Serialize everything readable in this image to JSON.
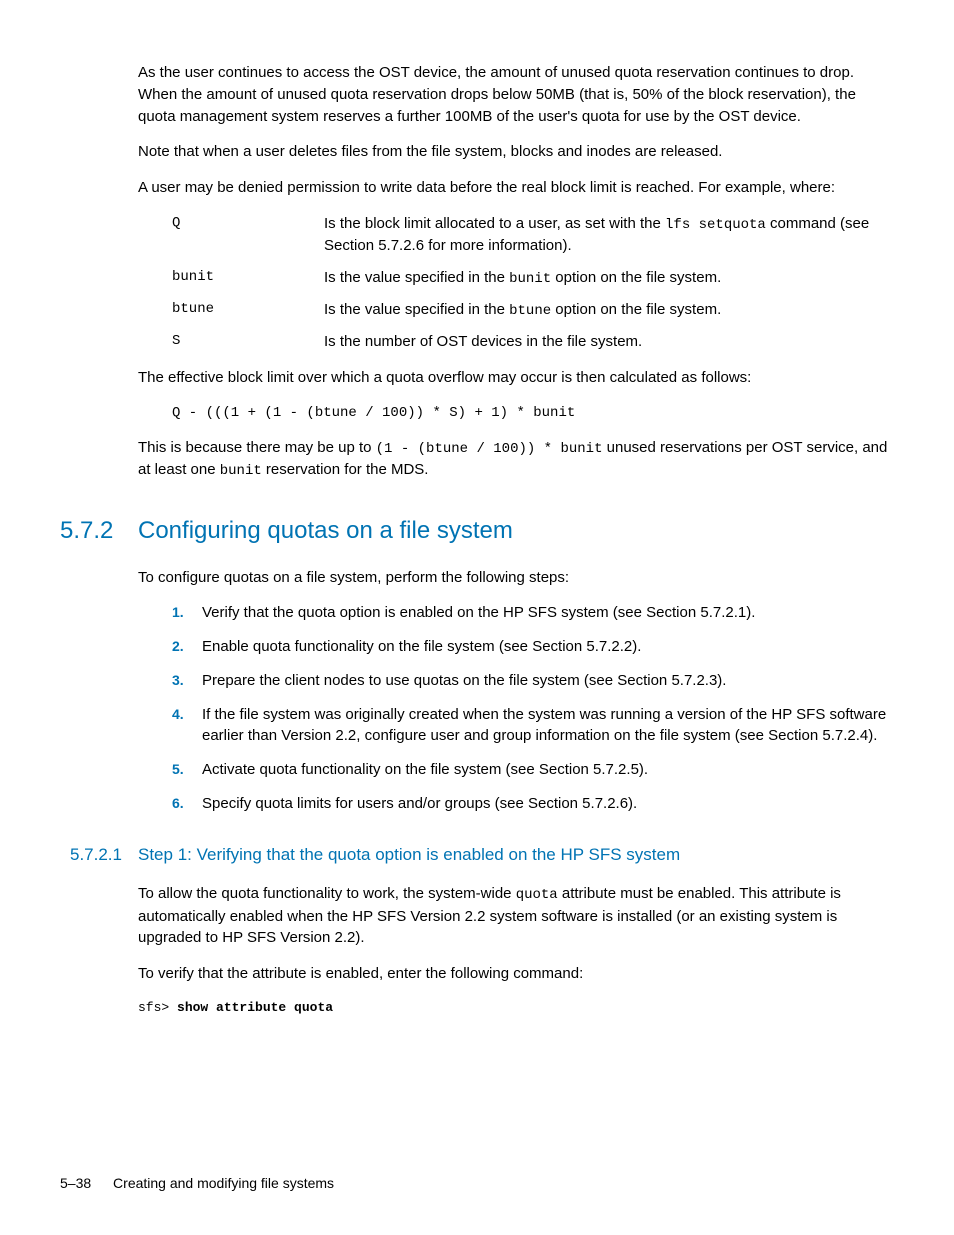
{
  "paragraphs": {
    "p1": "As the user continues to access the OST device, the amount of unused quota reservation continues to drop. When the amount of unused quota reservation drops below 50MB (that is, 50% of the block reservation), the quota management system reserves a further 100MB of the user's quota for use by the OST device.",
    "p2": "Note that when a user deletes files from the file system, blocks and inodes are released.",
    "p3": "A user may be denied permission to write data before the real block limit is reached. For example, where:",
    "p4": "The effective block limit over which a quota overflow may occur is then calculated as follows:",
    "p5_pre": "This is because there may be up to ",
    "p5_code": "(1 - (btune / 100)) * bunit",
    "p5_mid": " unused reservations per OST service, and at least one ",
    "p5_code2": "bunit",
    "p5_post": " reservation for the MDS.",
    "p6": "To configure quotas on a file system, perform the following steps:",
    "p7_pre": "To allow the quota functionality to work, the system-wide ",
    "p7_code": "quota",
    "p7_post": " attribute must be enabled. This attribute is automatically enabled when the HP SFS Version 2.2 system software is installed (or an existing system is upgraded to HP SFS Version 2.2).",
    "p8": "To verify that the attribute is enabled, enter the following command:"
  },
  "definitions": [
    {
      "term": "Q",
      "desc_pre": "Is the block limit allocated to a user, as set with the ",
      "desc_code": "lfs setquota",
      "desc_post": " command (see Section 5.7.2.6 for more information)."
    },
    {
      "term": "bunit",
      "desc_pre": "Is the value specified in the ",
      "desc_code": "bunit",
      "desc_post": " option on the file system."
    },
    {
      "term": "btune",
      "desc_pre": "Is the value specified in the ",
      "desc_code": "btune",
      "desc_post": " option on the file system."
    },
    {
      "term": "S",
      "desc_pre": "Is the number of OST devices in the file system.",
      "desc_code": "",
      "desc_post": ""
    }
  ],
  "formula": "Q - (((1 + (1 - (btune / 100)) * S) + 1) * bunit",
  "section": {
    "num": "5.7.2",
    "title": "Configuring quotas on a file system"
  },
  "steps": [
    {
      "num": "1.",
      "text": "Verify that the quota option is enabled on the HP SFS system (see Section 5.7.2.1)."
    },
    {
      "num": "2.",
      "text": "Enable quota functionality on the file system (see Section 5.7.2.2)."
    },
    {
      "num": "3.",
      "text": "Prepare the client nodes to use quotas on the file system (see Section 5.7.2.3)."
    },
    {
      "num": "4.",
      "text": "If the file system was originally created when the system was running a version of the HP SFS software earlier than Version 2.2, configure user and group information on the file system (see Section 5.7.2.4)."
    },
    {
      "num": "5.",
      "text": "Activate quota functionality on the file system (see Section 5.7.2.5)."
    },
    {
      "num": "6.",
      "text": "Specify quota limits for users and/or groups (see Section 5.7.2.6)."
    }
  ],
  "subsection": {
    "num": "5.7.2.1",
    "title": "Step 1: Verifying that the quota option is enabled on the HP SFS system"
  },
  "code": {
    "prompt": "sfs> ",
    "cmd": "show attribute quota"
  },
  "footer": {
    "page": "5–38",
    "chapter": "Creating and modifying file systems"
  }
}
